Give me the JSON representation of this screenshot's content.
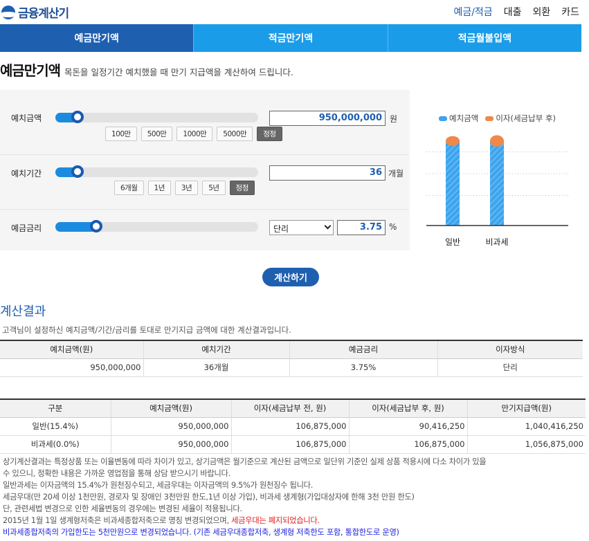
{
  "header": {
    "logo_text": "금융계산기",
    "nav": [
      "예금/적금",
      "대출",
      "외환",
      "카드"
    ]
  },
  "tabs": [
    "예금만기액",
    "적금만기액",
    "적금월불입액"
  ],
  "page": {
    "title": "예금만기액",
    "subtitle": "목돈을 일정기간 예치했을 때 만기 지급액을 계산하여 드립니다."
  },
  "calculator": {
    "amount": {
      "label": "예치금액",
      "value": "950,000,000",
      "unit": "원",
      "slider_fraction": 0.11,
      "chips": [
        "100만",
        "500만",
        "1000만",
        "5000만",
        "정정"
      ]
    },
    "period": {
      "label": "예치기간",
      "value": "36",
      "unit": "개월",
      "slider_fraction": 0.11,
      "chips": [
        "6개월",
        "1년",
        "3년",
        "5년",
        "정정"
      ]
    },
    "rate": {
      "label": "예금금리",
      "interest_type": "단리",
      "value": "3.75",
      "unit": "%",
      "slider_fraction": 0.2
    },
    "calc_button": "계산하기"
  },
  "chart_data": {
    "type": "bar",
    "categories": [
      "일반",
      "비과세"
    ],
    "series": [
      {
        "name": "예치금액",
        "values": [
          950000000,
          950000000
        ],
        "color": "#3da3ee"
      },
      {
        "name": "이자(세금납부 후)",
        "values": [
          90416250,
          106875000
        ],
        "color": "#f0884a"
      }
    ],
    "stacked": true,
    "grid": true,
    "legend": "top"
  },
  "result": {
    "title": "계산결과",
    "desc": "고객님이 설정하신 예치금액/기간/금리를 토대로 만기지급 금액에 대한 계산결과입니다.",
    "summary_headers": [
      "예치금액(원)",
      "예치기간",
      "예금금리",
      "이자방식"
    ],
    "summary_row": [
      "950,000,000",
      "36개월",
      "3.75%",
      "단리"
    ],
    "detail_headers": [
      "구분",
      "예치금액(원)",
      "이자(세금납부 전, 원)",
      "이자(세금납부 후, 원)",
      "만기지급액(원)"
    ],
    "detail_rows": [
      [
        "일반(15.4%)",
        "950,000,000",
        "106,875,000",
        "90,416,250",
        "1,040,416,250"
      ],
      [
        "비과세(0.0%)",
        "950,000,000",
        "106,875,000",
        "106,875,000",
        "1,056,875,000"
      ]
    ]
  },
  "notes": {
    "l1": "상기계산결과는 특정상품 또는 이율변동에 따라 차이가 있고, 상기금액은 월기준으로 계산된 금액으로 일단위 기준인 실제 상품 적용시에 다소 차이가 있을",
    "l2": "수 있으니, 정확한 내용은 가까운 영업점을 통해 상담 받으시기 바랍니다.",
    "l3": "일반과세는 이자금액의 15.4%가 원천징수되고, 세금우대는 이자금액의 9.5%가 원천징수 됩니다.",
    "l4": "세금우대(만 20세 이상 1천만원, 경로자 및 장애인 3천만원 한도,1년 이상 가입), 비과세 생계형(가입대상자에 한해 3천 만원 한도)",
    "l5": "단, 관련세법 변경으로 인한 세율변동의 경우에는 변경된 세율이 적용됩니다.",
    "l6a": "2015년 1월 1일 생계형저축은 비과세종합저축으로 명칭 변경되었으며, ",
    "l6b": "세금우대는 폐지되었습니다.",
    "l7a": "비과세종합저축의 가입한도는 5천만원으로 변경되었습니다.",
    "l7b": " (기존 세금우대종합저축, 생계형 저축한도 포함, 통합한도로 운영)"
  }
}
